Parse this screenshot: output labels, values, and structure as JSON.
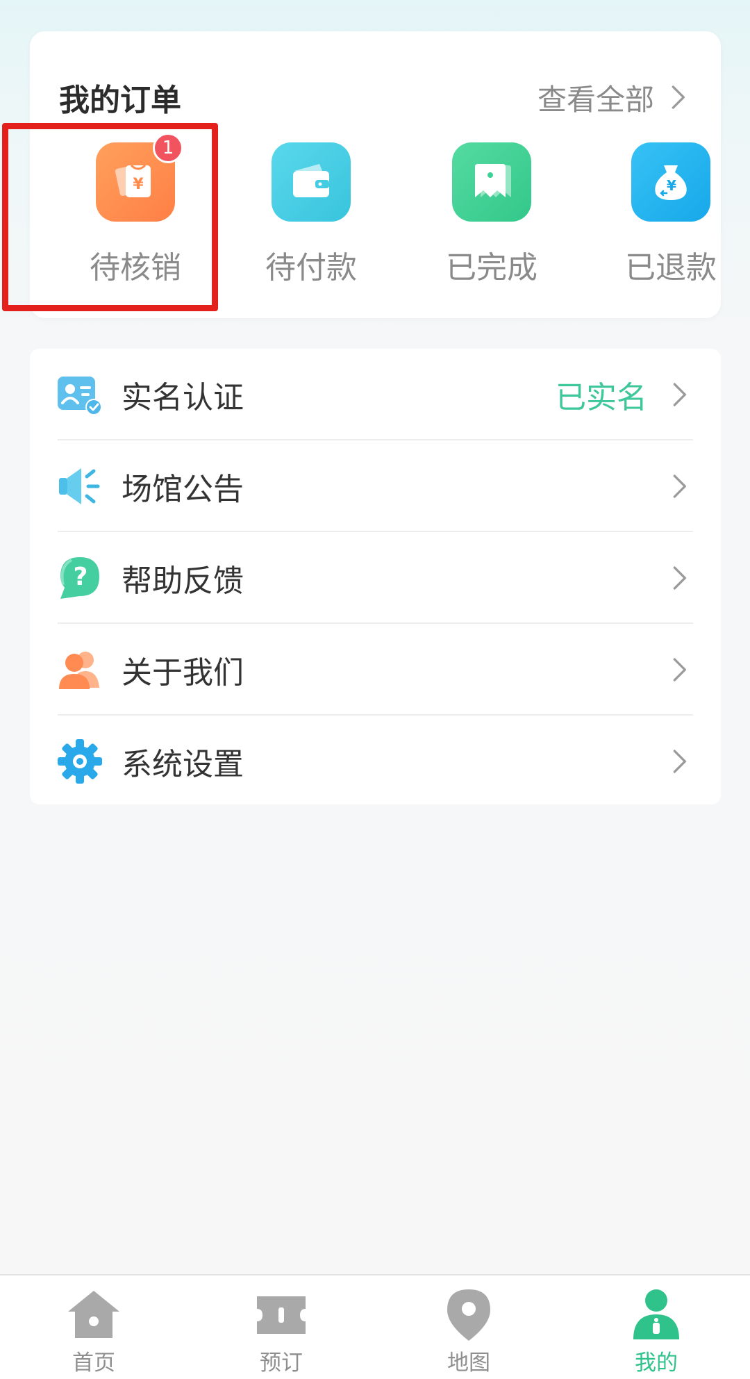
{
  "orders": {
    "title": "我的订单",
    "view_all": "查看全部",
    "items": [
      {
        "label": "待核销",
        "badge": "1",
        "icon": "voucher-icon",
        "color": "#ff8f4f"
      },
      {
        "label": "待付款",
        "icon": "wallet-icon",
        "color": "#43cde3"
      },
      {
        "label": "已完成",
        "icon": "ticket-icon",
        "color": "#3ed195"
      },
      {
        "label": "已退款",
        "icon": "money-bag-icon",
        "color": "#1fb3ef"
      }
    ]
  },
  "menu": [
    {
      "label": "实名认证",
      "value": "已实名",
      "icon": "id-card-icon"
    },
    {
      "label": "场馆公告",
      "icon": "speaker-icon"
    },
    {
      "label": "帮助反馈",
      "icon": "help-icon"
    },
    {
      "label": "关于我们",
      "icon": "users-icon"
    },
    {
      "label": "系统设置",
      "icon": "gear-icon"
    }
  ],
  "tabbar": [
    {
      "label": "首页",
      "icon": "home-icon"
    },
    {
      "label": "预订",
      "icon": "ticket-tab-icon"
    },
    {
      "label": "地图",
      "icon": "map-pin-icon"
    },
    {
      "label": "我的",
      "icon": "profile-icon",
      "active": true
    }
  ],
  "colors": {
    "accent": "#30c28b",
    "verified": "#3ec79a",
    "badge": "#f1535f",
    "highlight": "#e3201c"
  }
}
